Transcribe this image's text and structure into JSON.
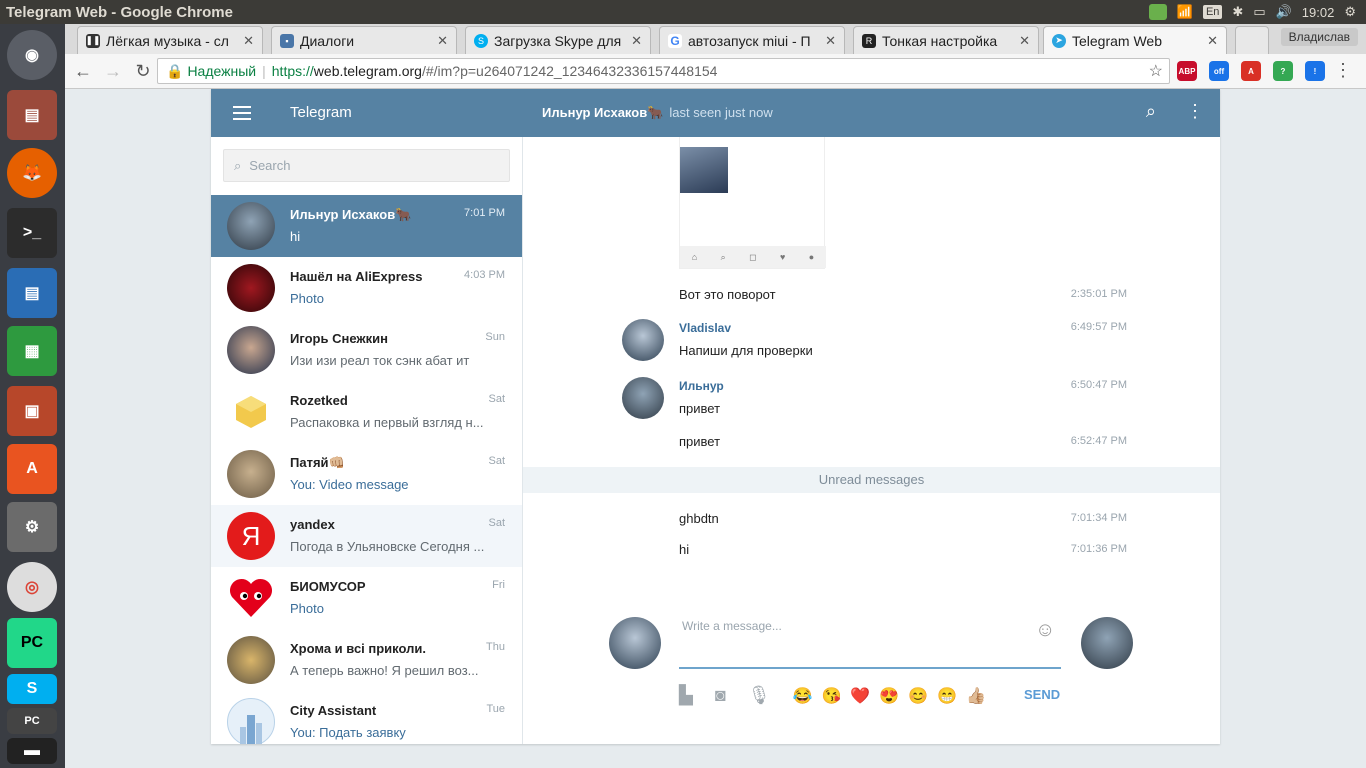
{
  "os": {
    "window_title": "Telegram Web - Google Chrome",
    "keyboard_lang": "En",
    "clock": "19:02"
  },
  "browser": {
    "tabs": [
      {
        "label": "Лёгкая музыка - сл",
        "icon": "pause-icon",
        "color": "#333333"
      },
      {
        "label": "Диалоги",
        "icon": "chat-icon",
        "color": "#4a76a8"
      },
      {
        "label": "Загрузка Skype для",
        "icon": "skype-icon",
        "color": "#00aff0"
      },
      {
        "label": "автозапуск miui - П",
        "icon": "google-icon",
        "color": "#4285f4"
      },
      {
        "label": "Тонкая настройка",
        "icon": "site-icon",
        "color": "#222222"
      },
      {
        "label": "Telegram Web",
        "icon": "telegram-icon",
        "color": "#2ca5e0"
      }
    ],
    "user": "Владислав",
    "secure_label": "Надежный",
    "url_scheme": "https://",
    "url_host": "web.telegram.org",
    "url_rest": "/#/im?p=u264071242_12346432336157448154",
    "extensions": [
      {
        "label": "ABP",
        "color": "#c70d2c"
      },
      {
        "label": "off",
        "color": "#1a73e8"
      },
      {
        "label": "A",
        "color": "#d93025"
      },
      {
        "label": "?",
        "color": "#34a853"
      },
      {
        "label": "!",
        "color": "#1a73e8"
      }
    ]
  },
  "telegram": {
    "brand": "Telegram",
    "peer_name": "Ильнур Исхаков🐂",
    "peer_status": "last seen just now",
    "search_placeholder": "Search",
    "dialogs": [
      {
        "name": "Ильнур Исхаков🐂",
        "time": "7:01 PM",
        "message": "hi",
        "avatar": "#4b5563",
        "media": false
      },
      {
        "name": "Нашёл на AliExpress",
        "time": "4:03 PM",
        "message": "Photo",
        "avatar": "#5a0f14",
        "media": true
      },
      {
        "name": "Игорь Снежкин",
        "time": "Sun",
        "message": "Изи изи реал ток сэнк абат ит",
        "avatar": "#2b3340",
        "media": false
      },
      {
        "name": "Rozetked",
        "time": "Sat",
        "message": "Распаковка и первый взгляд н...",
        "avatar": "#f2c94c",
        "media": false
      },
      {
        "name": "Патяй👊🏼",
        "time": "Sat",
        "message": "You: Video message",
        "avatar": "#9c8b6e",
        "media": true
      },
      {
        "name": "yandex",
        "time": "Sat",
        "message": "Погода в Ульяновске Сегодня ...",
        "avatar": "#e31b1b",
        "media": false
      },
      {
        "name": "БИОМУСОР",
        "time": "Fri",
        "message": "Photo",
        "avatar": "#ffffff",
        "media": true
      },
      {
        "name": "Хрома и всі приколи.",
        "time": "Thu",
        "message": "А теперь важно! Я решил воз...",
        "avatar": "#8a7a55",
        "media": false
      },
      {
        "name": "City Assistant",
        "time": "Tue",
        "message": "You: Подать заявку",
        "avatar": "#dbe9f5",
        "media": true
      }
    ],
    "messages": [
      {
        "text": "Вот это поворот",
        "time": "2:35:01 PM"
      },
      {
        "author": "Vladislav",
        "text": "Напиши для проверки",
        "time": "6:49:57 PM"
      },
      {
        "author": "Ильнур",
        "text": "привет",
        "time": "6:50:47 PM"
      },
      {
        "text": "привет",
        "time": "6:52:47 PM"
      },
      {
        "text": "ghbdtn",
        "time": "7:01:34 PM"
      },
      {
        "text": "hi",
        "time": "7:01:36 PM"
      }
    ],
    "unread_label": "Unread messages",
    "compose_placeholder": "Write a message...",
    "send_label": "SEND",
    "emojis": [
      "😂",
      "😘",
      "❤️",
      "😍",
      "😊",
      "😁",
      "👍🏼"
    ]
  }
}
